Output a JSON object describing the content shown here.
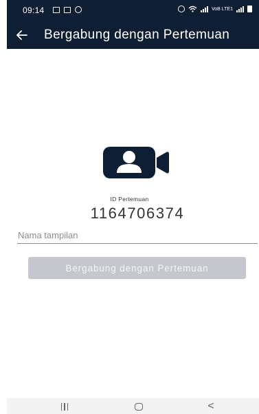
{
  "status_bar": {
    "time": "09:14",
    "left_icons": [
      "image-icon",
      "calendar-icon",
      "sync-icon"
    ],
    "right_icons": [
      "alarm-icon",
      "wifi-icon",
      "signal-icon",
      "volte-icon",
      "signal-icon",
      "battery-icon"
    ],
    "volte_text": "VoB LTE1"
  },
  "app_bar": {
    "back_icon": "arrow-left-icon",
    "title": "Bergabung dengan Pertemuan"
  },
  "main": {
    "camera_icon": "video-camera-user-icon",
    "meeting_id_label": "ID Pertemuan",
    "meeting_id_value": "1164706374",
    "display_name": {
      "value": "",
      "placeholder": "Nama tampilan"
    },
    "join_button_label": "Bergabung dengan Pertemuan"
  },
  "nav_bar": {
    "icons": [
      "recents-icon",
      "home-icon",
      "back-icon"
    ],
    "back_glyph": "<"
  },
  "colors": {
    "header": "#0f1f33",
    "icon": "#0f1f33",
    "button_disabled": "#c4c7cc",
    "text": "#333333"
  }
}
